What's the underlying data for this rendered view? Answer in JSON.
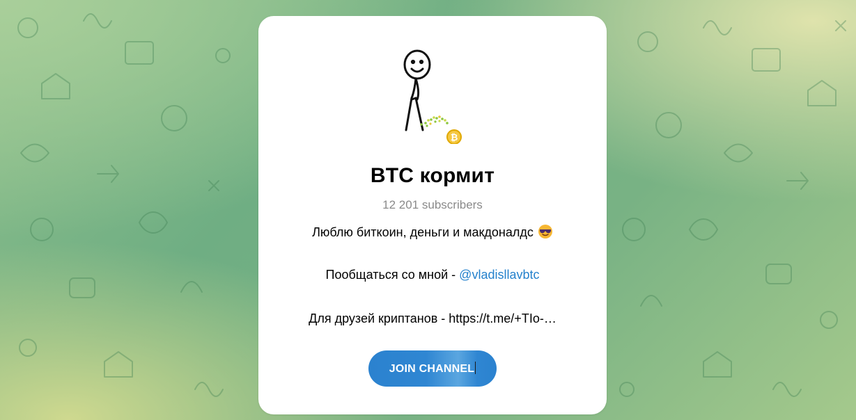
{
  "channel": {
    "title": "BTC кормит",
    "subscribers": "12 201 subscribers",
    "description_line1": "Люблю биткоин, деньги и макдоналдс",
    "description_line2_prefix": "Пообщаться со мной - ",
    "contact_handle": "@vladisllavbtc",
    "description_line3": "Для друзей криптанов - https://t.me/+TIo-…",
    "emoji_icon": "smiling-face-with-sunglasses-icon",
    "avatar_icon": "stick-figure-bitcoin-icon"
  },
  "join_button": {
    "label": "JOIN CHANNEL"
  },
  "colors": {
    "link": "#2481cc",
    "button": "#2b82cf",
    "subscribers_text": "#8a8a8a"
  }
}
